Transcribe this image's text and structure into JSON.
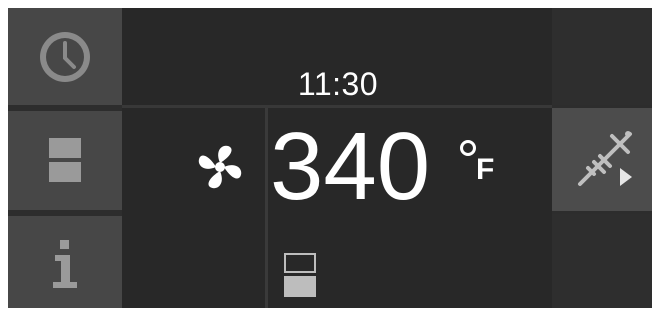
{
  "header": {
    "time": "11:30"
  },
  "display": {
    "temperature": "340",
    "unit": "F",
    "mode_icon": "convection-fan-icon"
  },
  "left_menu": [
    {
      "icon": "clock-icon"
    },
    {
      "icon": "upper-lower-oven-icon"
    },
    {
      "icon": "info-icon"
    }
  ],
  "right_menu": [
    {
      "icon": "",
      "active": false
    },
    {
      "icon": "meat-probe-icon",
      "active": true
    },
    {
      "icon": "",
      "active": false
    }
  ],
  "oven_selector": {
    "icon": "lower-oven-selected-icon"
  },
  "colors": {
    "panel": "#2d2d2d",
    "side_button": "#474747",
    "active_button": "#4c4c4c",
    "text": "#ffffff",
    "icon": "#cfcfcf"
  }
}
